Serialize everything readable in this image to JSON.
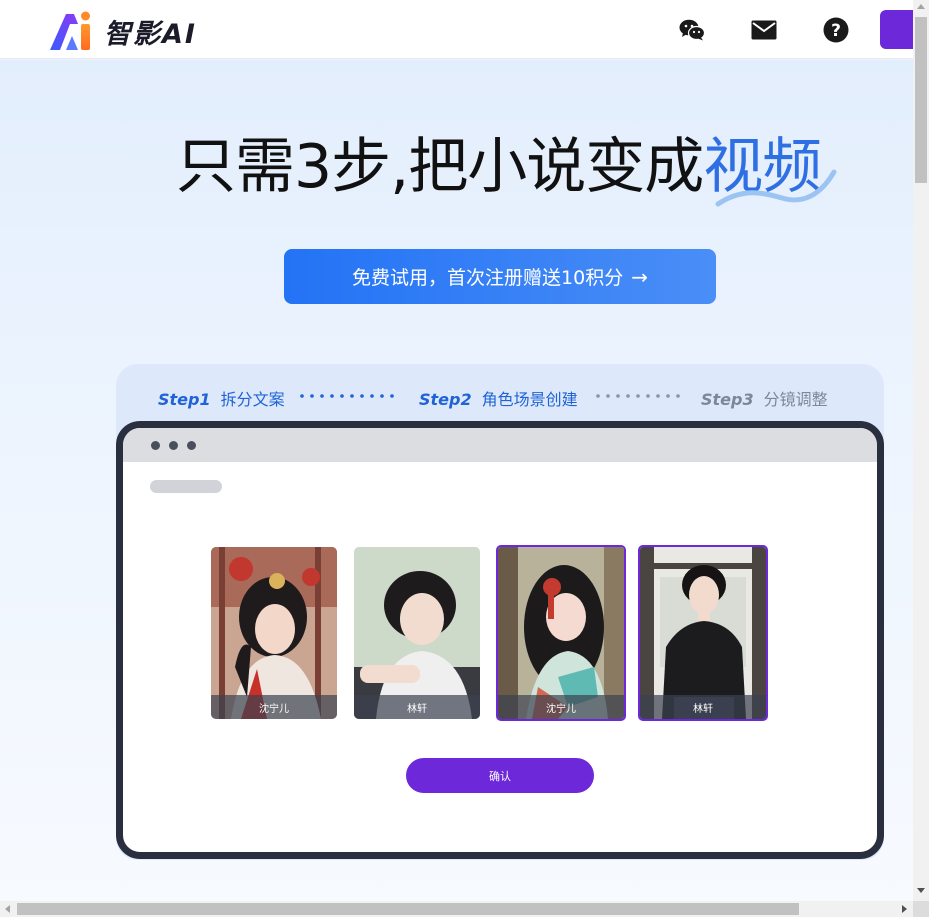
{
  "header": {
    "brand_text": "智影AI",
    "icons": [
      "wechat-icon",
      "mail-icon",
      "help-icon"
    ]
  },
  "hero": {
    "headline_main": "只需3步,把小说变成",
    "headline_highlight": "视频",
    "cta_label": "免费试用，首次注册赠送10积分",
    "cta_arrow": "→"
  },
  "steps": [
    {
      "num": "Step1",
      "label": "拆分文案",
      "state": "active"
    },
    {
      "num": "Step2",
      "label": "角色场景创建",
      "state": "active"
    },
    {
      "num": "Step3",
      "label": "分镜调整",
      "state": "inactive"
    }
  ],
  "characters": [
    {
      "name": "沈宁儿",
      "selected": false
    },
    {
      "name": "林轩",
      "selected": false
    },
    {
      "name": "沈宁儿",
      "selected": true
    },
    {
      "name": "林轩",
      "selected": true
    }
  ],
  "confirm_label": "确认",
  "colors": {
    "brand_purple": "#6d28d9",
    "brand_blue": "#2373f5",
    "highlight_blue": "#2f6fe4",
    "frame_dark": "#2a2f3f"
  }
}
